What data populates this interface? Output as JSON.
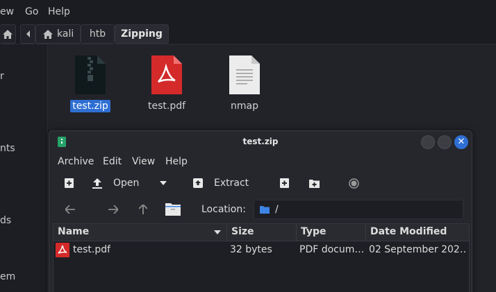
{
  "file_manager": {
    "menubar": {
      "view": "ew",
      "go": "Go",
      "help": "Help"
    },
    "pathbar": {
      "segments": [
        "kali",
        "htb",
        "Zipping"
      ]
    },
    "sidebar": {
      "items": [
        "r",
        "nts",
        "ds",
        "em"
      ]
    },
    "files": [
      {
        "name": "test.zip",
        "icon": "zip-archive-icon",
        "selected": true
      },
      {
        "name": "test.pdf",
        "icon": "pdf-file-icon",
        "selected": false
      },
      {
        "name": "nmap",
        "icon": "text-file-icon",
        "selected": false
      }
    ]
  },
  "archive_window": {
    "title": "test.zip",
    "menu": {
      "archive": "Archive",
      "edit": "Edit",
      "view": "View",
      "help": "Help"
    },
    "toolbar": {
      "open": "Open",
      "extract": "Extract"
    },
    "location": {
      "label": "Location:",
      "path": "/"
    },
    "table": {
      "columns": [
        "Name",
        "Size",
        "Type",
        "Date Modified"
      ],
      "rows": [
        {
          "name": "test.pdf",
          "size": "32 bytes",
          "type": "PDF docum…",
          "date": "02 September 202…"
        }
      ]
    },
    "colors": {
      "accent": "#2f6fd3",
      "pdf": "#d42a2a",
      "folder": "#3d84e6"
    }
  }
}
